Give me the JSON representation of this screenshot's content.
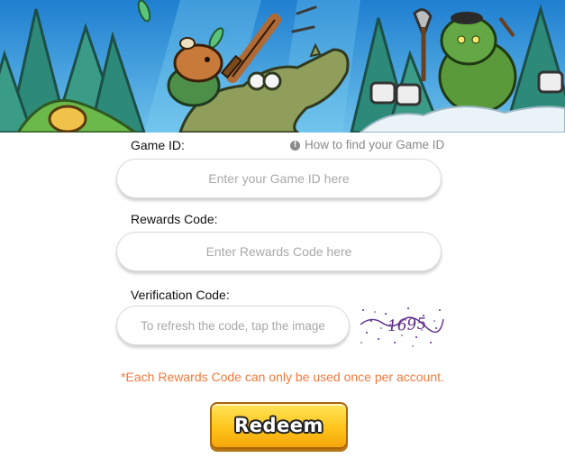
{
  "banner": {
    "colors": {
      "sky": "#3ea0e0",
      "trees": "#2f8f7a",
      "capybara": "#c77a3a",
      "croc": "#8a9a58",
      "orc": "#5a9a3a",
      "cloud": "#eaf3f8"
    }
  },
  "form": {
    "game_id": {
      "label": "Game ID:",
      "placeholder": "Enter your Game ID here",
      "value": ""
    },
    "help_link": {
      "icon": "info-icon",
      "text": "How to find your Game ID"
    },
    "rewards_code": {
      "label": "Rewards Code:",
      "placeholder": "Enter Rewards Code here",
      "value": ""
    },
    "verification_code": {
      "label": "Verification Code:",
      "placeholder": "To refresh the code, tap the image",
      "value": "",
      "captcha_text": "1695"
    },
    "notice": "*Each Rewards Code can only be used once per account.",
    "redeem_label": "Redeem"
  },
  "colors": {
    "notice": "#f07a3c",
    "button_top": "#ffe45a",
    "button_bottom": "#f5a60b",
    "captcha_ink": "#5b2a8a"
  }
}
